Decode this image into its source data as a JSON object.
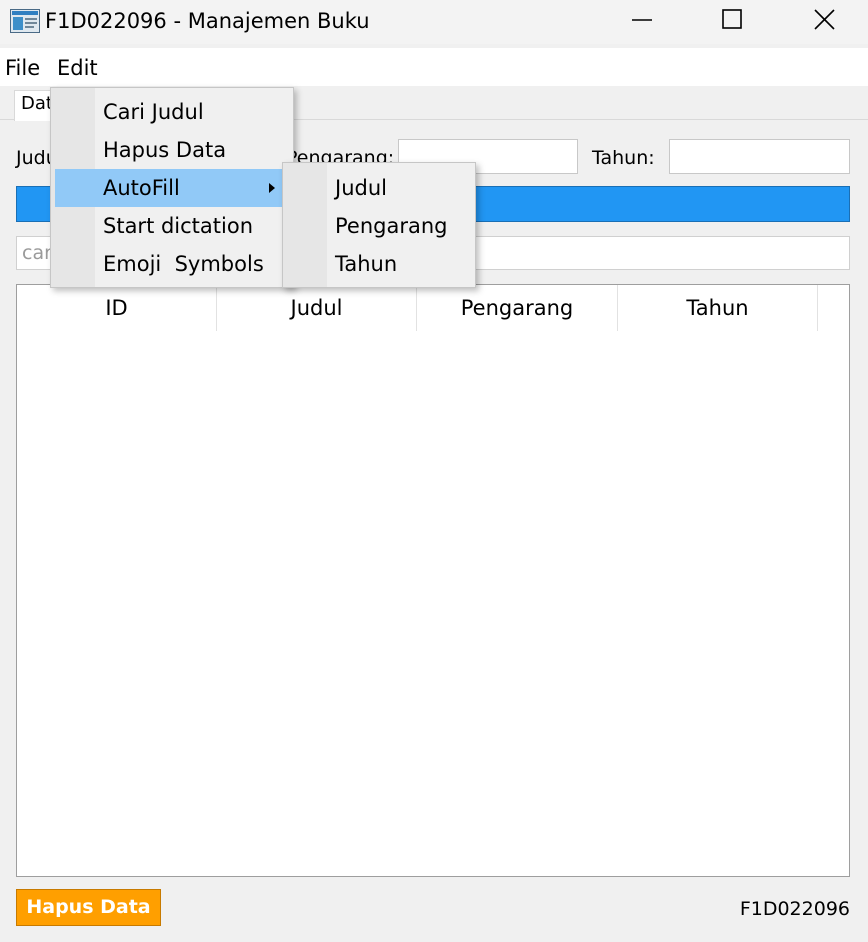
{
  "window": {
    "title": "F1D022096 - Manajemen Buku"
  },
  "menubar": {
    "file": "File",
    "edit": "Edit"
  },
  "tab": {
    "label": "Data"
  },
  "form": {
    "judul_label": "Judul:",
    "pengarang_label": "Pengarang:",
    "tahun_label": "Tahun:"
  },
  "search": {
    "placeholder": "cari judul..."
  },
  "table": {
    "columns": [
      "ID",
      "Judul",
      "Pengarang",
      "Tahun"
    ]
  },
  "footer": {
    "hapus_button": "Hapus Data",
    "student_id": "F1D022096"
  },
  "edit_menu": {
    "items": [
      "Cari Judul",
      "Hapus Data",
      "AutoFill",
      "Start dictation",
      "Emoji  Symbols"
    ],
    "highlighted": "AutoFill"
  },
  "autofill_submenu": {
    "items": [
      "Judul",
      "Pengarang",
      "Tahun"
    ]
  },
  "colors": {
    "accent_bar": "#2196f3",
    "hapus_button": "#ff9f00",
    "menu_highlight": "#91c9f7"
  }
}
